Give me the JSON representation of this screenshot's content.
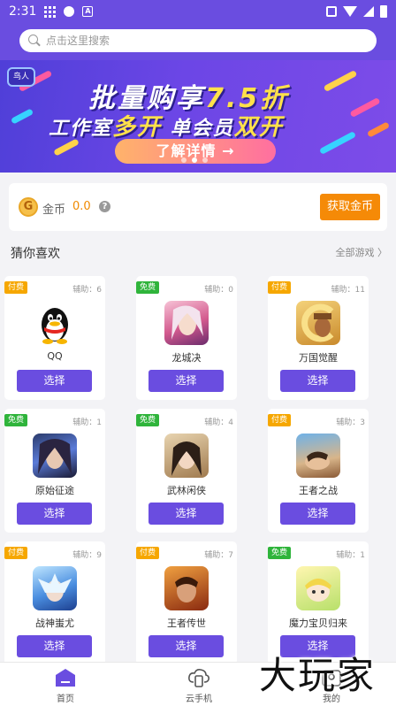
{
  "status_bar": {
    "time": "2:31"
  },
  "search": {
    "placeholder": "点击这里搜索"
  },
  "banner": {
    "logo_text": "鸟人",
    "line1_prefix": "批量购享",
    "line1_highlight": "7.5折",
    "line2_part1": "工作室",
    "line2_hl1": "多开",
    "line2_part2": " 单会员",
    "line2_hl2": "双开",
    "button_label": "了解详情 →",
    "slide_count": 3,
    "active_slide": 1
  },
  "coin": {
    "icon_letter": "G",
    "label": "金币",
    "value": "0.0",
    "help_icon": "?",
    "button_label": "获取金币"
  },
  "section": {
    "title": "猜你喜欢",
    "all_link": "全部游戏 〉"
  },
  "games": [
    {
      "tag": "付费",
      "tag_type": "paid",
      "assist": "辅助：6",
      "name": "QQ",
      "icon": "qq-penguin-icon",
      "button": "选择"
    },
    {
      "tag": "免费",
      "tag_type": "free",
      "assist": "辅助：0",
      "name": "龙城决",
      "icon": "longchengjue-icon",
      "button": "选择"
    },
    {
      "tag": "付费",
      "tag_type": "paid",
      "assist": "辅助：11",
      "name": "万国觉醒",
      "icon": "wanguojuexing-icon",
      "button": "选择"
    },
    {
      "tag": "免费",
      "tag_type": "free",
      "assist": "辅助：1",
      "name": "原始征途",
      "icon": "yuanshizhengtu-icon",
      "button": "选择"
    },
    {
      "tag": "免费",
      "tag_type": "free",
      "assist": "辅助：4",
      "name": "武林闲侠",
      "icon": "wulinxianxia-icon",
      "button": "选择"
    },
    {
      "tag": "付费",
      "tag_type": "paid",
      "assist": "辅助：3",
      "name": "王者之战",
      "icon": "wangzhezhizhan-icon",
      "button": "选择"
    },
    {
      "tag": "付费",
      "tag_type": "paid",
      "assist": "辅助：9",
      "name": "战神蚩尤",
      "icon": "zhanshenchiyou-icon",
      "button": "选择"
    },
    {
      "tag": "付费",
      "tag_type": "paid",
      "assist": "辅助：7",
      "name": "王者传世",
      "icon": "wangzhechuanshi-icon",
      "button": "选择"
    },
    {
      "tag": "免费",
      "tag_type": "free",
      "assist": "辅助：1",
      "name": "魔力宝贝归来",
      "icon": "molibaobei-icon",
      "button": "选择"
    }
  ],
  "nav": [
    {
      "label": "首页",
      "icon": "home-icon",
      "active": true
    },
    {
      "label": "云手机",
      "icon": "cloud-phone-icon",
      "active": false
    },
    {
      "label": "我的",
      "icon": "profile-icon",
      "active": false
    }
  ],
  "watermark": "大玩家",
  "colors": {
    "brand": "#6a4de0",
    "coin_orange": "#f58a07",
    "paid_tag": "#f6a700",
    "free_tag": "#2fb43b"
  }
}
